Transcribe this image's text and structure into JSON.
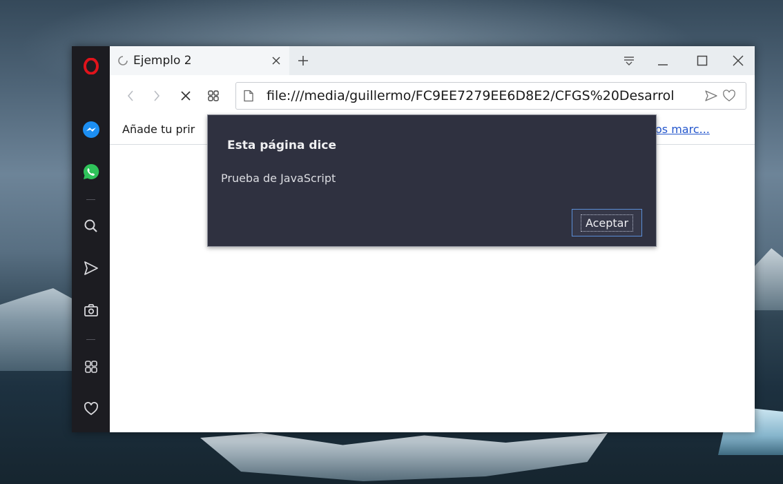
{
  "tab": {
    "title": "Ejemplo 2"
  },
  "address_bar": {
    "url": "file:///media/guillermo/FC9EE7279EE6D8E2/CFGS%20Desarrol"
  },
  "bookmarks_bar": {
    "left_text": "Añade tu prir",
    "right_link": "os marc..."
  },
  "dialog": {
    "title": "Esta página dice",
    "message": "Prueba de JavaScript",
    "ok_label": "Aceptar"
  },
  "sidebar": {
    "items": [
      "opera-logo",
      "messenger",
      "whatsapp",
      "search",
      "send",
      "snapshot",
      "speed-dial",
      "favorites"
    ]
  },
  "colors": {
    "opera_red": "#e0131b",
    "messenger_blue": "#1c8ef2",
    "whatsapp_green": "#2fc35a",
    "dialog_bg": "#2f3140",
    "sidebar_bg": "#1c1c21",
    "link_blue": "#2255cc"
  }
}
